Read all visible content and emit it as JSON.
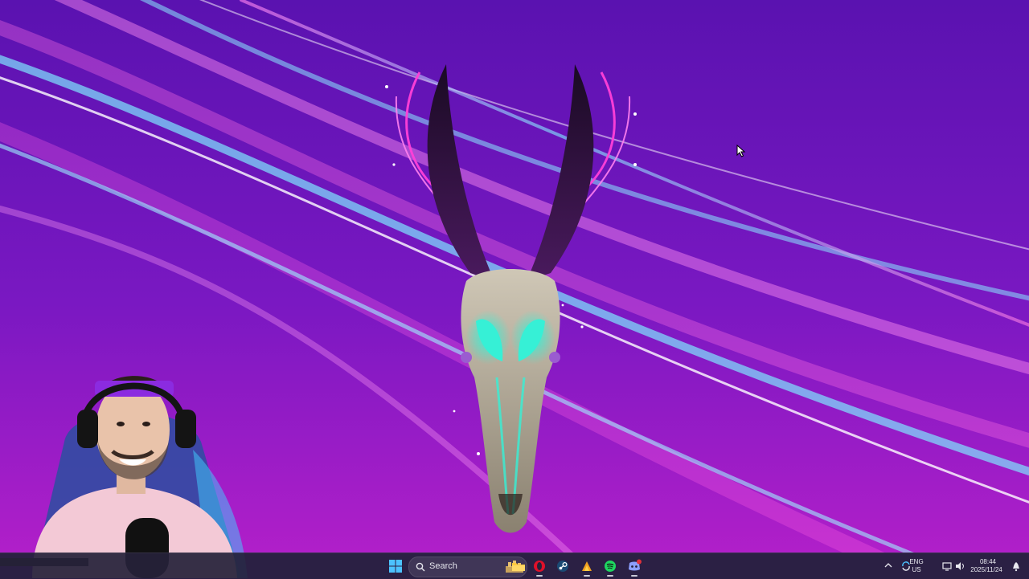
{
  "desktop": {
    "wallpaper_name": "neon-antelope-skull-wallpaper",
    "colors": {
      "background_top": "#5a12b0",
      "background_bottom": "#b01fc9",
      "streak_cyan": "#5fd8ff",
      "streak_pink": "#ff5fe6",
      "neon_pink": "#ff3fd8",
      "skull_eyes": "#36f0d6"
    }
  },
  "webcam": {
    "name": "streamer-webcam-overlay",
    "headband_color": "#8b2be0",
    "shirt_color": "#f3c9d6"
  },
  "taskbar": {
    "search": {
      "label": "Search",
      "icon": "search-icon"
    },
    "apps": [
      {
        "name": "file-explorer-icon"
      },
      {
        "name": "opera-gx-icon"
      },
      {
        "name": "steam-icon"
      },
      {
        "name": "app-flame-icon"
      },
      {
        "name": "spotify-icon"
      },
      {
        "name": "discord-icon",
        "badge": ""
      }
    ],
    "tray": {
      "language_top": "ENG",
      "language_bottom": "US",
      "time": "08:44",
      "date": "2025/11/24"
    }
  }
}
